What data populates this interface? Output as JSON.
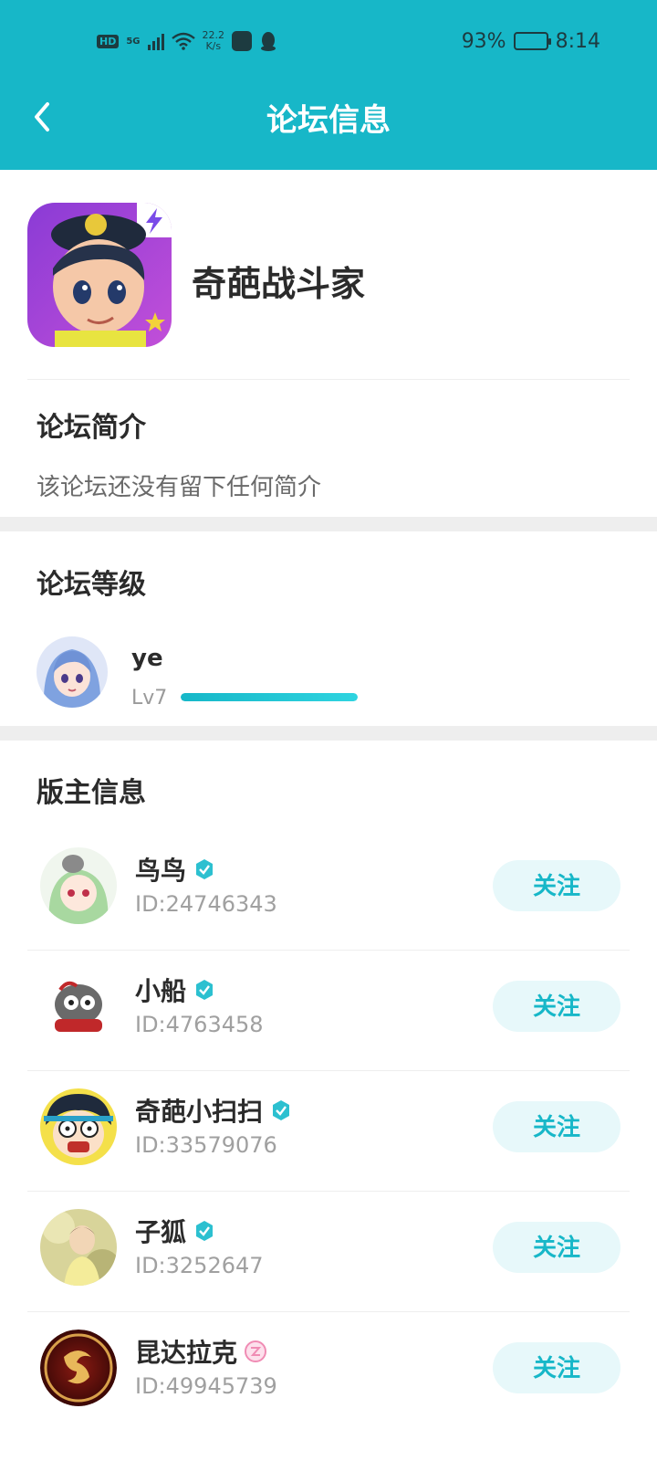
{
  "status_bar": {
    "hd": "HD",
    "net_type": "5G",
    "speed_value": "22.2",
    "speed_unit": "K/s",
    "battery": "93%",
    "time": "8:14"
  },
  "header": {
    "title": "论坛信息",
    "back_icon": "chevron-left-icon"
  },
  "forum": {
    "name": "奇葩战斗家"
  },
  "intro": {
    "title": "论坛简介",
    "text": "该论坛还没有留下任何简介"
  },
  "level": {
    "title": "论坛等级",
    "user_name": "ye",
    "level_label": "Lv7",
    "progress": 1.0
  },
  "moderators": {
    "title": "版主信息",
    "follow_label": "关注",
    "items": [
      {
        "name": "鸟鸟",
        "id": "ID:24746343",
        "badge": "verified-icon"
      },
      {
        "name": "小船",
        "id": "ID:4763458",
        "badge": "verified-icon"
      },
      {
        "name": "奇葩小扫扫",
        "id": "ID:33579076",
        "badge": "verified-icon"
      },
      {
        "name": "子狐",
        "id": "ID:3252647",
        "badge": "verified-icon"
      },
      {
        "name": "昆达拉克",
        "id": "ID:49945739",
        "badge": "creator-badge-icon"
      }
    ]
  },
  "colors": {
    "accent": "#17b7c8",
    "follow_bg": "#e7f8fa",
    "divider": "#eeeeee"
  }
}
